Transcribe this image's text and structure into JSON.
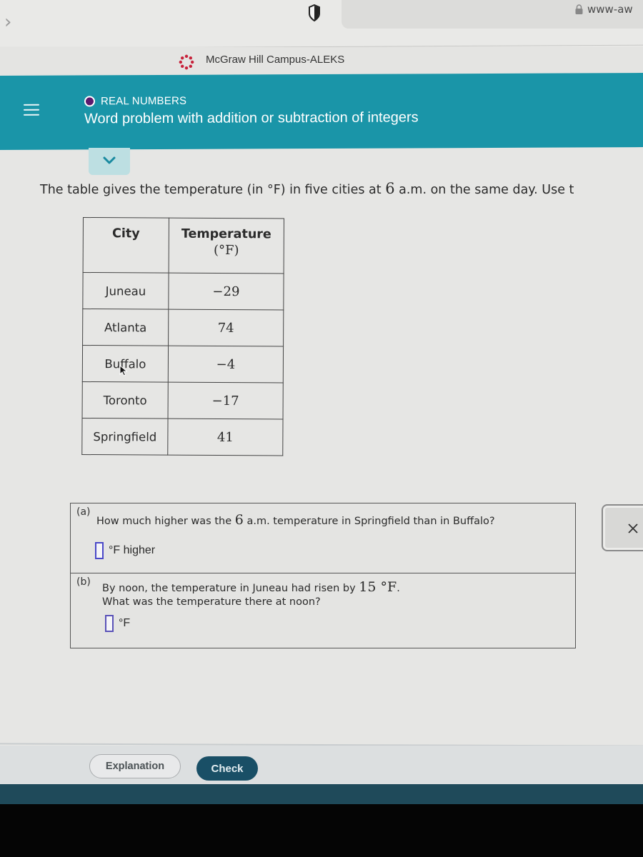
{
  "browser": {
    "url_text": "www-aw",
    "tab_title": "McGraw Hill Campus-ALEKS",
    "icons": {
      "back": "chevron-right-icon",
      "privacy": "shield-icon",
      "secure": "lock-icon",
      "site": "mcgraw-hill-logo"
    }
  },
  "header": {
    "topic": "REAL NUMBERS",
    "lesson_title": "Word problem with addition or subtraction of integers",
    "accent_color": "#1a95a8",
    "topic_dot_color": "#5b1a6e"
  },
  "problem": {
    "intro_before": "The table gives the temperature (in °F) in five cities at ",
    "intro_num": "6",
    "intro_after": " a.m. on the same day. Use t",
    "table": {
      "headers": [
        "City",
        "Temperature",
        "(°F)"
      ],
      "rows": [
        {
          "city": "Juneau",
          "temp": "−29"
        },
        {
          "city": "Atlanta",
          "temp": "74"
        },
        {
          "city": "Buffalo",
          "temp": "−4"
        },
        {
          "city": "Toronto",
          "temp": "−17"
        },
        {
          "city": "Springfield",
          "temp": "41"
        }
      ]
    },
    "part_a": {
      "letter": "(a)",
      "text_before": "How much higher was the ",
      "text_num": "6",
      "text_after": " a.m. temperature in Springfield than in Buffalo?",
      "answer_value": "",
      "unit": "°F higher"
    },
    "part_b": {
      "letter": "(b)",
      "line1_before": "By noon, the temperature in Juneau had risen by ",
      "line1_num": "15 °F",
      "line1_after": ".",
      "line2": "What was the temperature there at noon?",
      "answer_value": "",
      "unit": "°F"
    }
  },
  "actions": {
    "clear_label": "×",
    "explanation_label": "Explanation",
    "check_label": "Check",
    "check_color": "#194f66"
  }
}
